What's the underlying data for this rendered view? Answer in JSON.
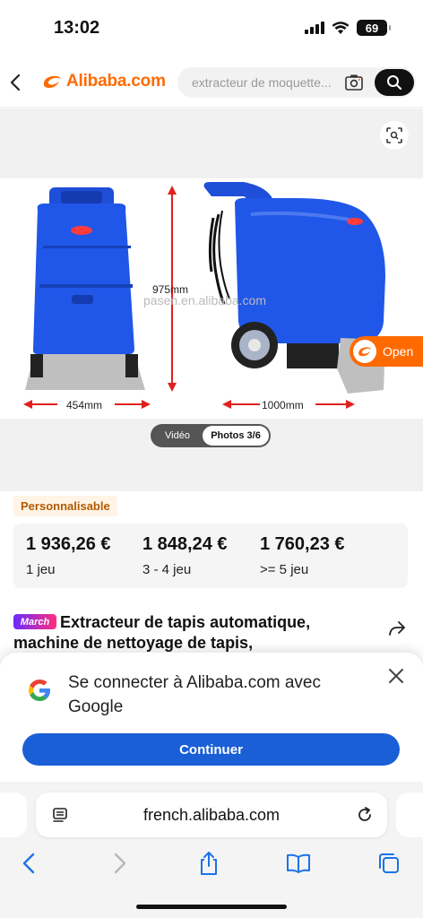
{
  "status_bar": {
    "time": "13:02",
    "battery": "69"
  },
  "header": {
    "logo_text": "Alibaba.com",
    "search_placeholder": "extracteur de moquette...",
    "icons": {
      "back": "chevron-left-icon",
      "camera": "camera-search-icon",
      "search": "search-icon"
    }
  },
  "gallery": {
    "open_label": "Open",
    "watermark": "pasen.en.alibaba.com",
    "dim_height": "975mm",
    "dim_width_left": "454mm",
    "dim_width_right": "1000mm",
    "media_tabs": [
      {
        "label": "Vidéo",
        "active": false
      },
      {
        "label": "Photos 3/6",
        "active": true
      }
    ],
    "colors": {
      "machine_blue": "#1f4fd8",
      "accent": "#ff6a00"
    }
  },
  "badge": "Personnalisable",
  "prices": [
    {
      "value": "1 936,26 €",
      "qty": "1 jeu"
    },
    {
      "value": "1 848,24 €",
      "qty": "3 - 4 jeu"
    },
    {
      "value": "1 760,23 €",
      "qty": ">= 5 jeu"
    }
  ],
  "product": {
    "promo_badge": "March",
    "title": "Extracteur de tapis automatique, machine de nettoyage de tapis,"
  },
  "google_sheet": {
    "text": "Se connecter à Alibaba.com avec Google",
    "button": "Continuer",
    "button_color": "#1a5fd6"
  },
  "browser": {
    "url": "french.alibaba.com",
    "toolbar_icons": [
      "back-icon",
      "forward-icon",
      "share-icon",
      "bookmarks-icon",
      "tabs-icon"
    ]
  }
}
